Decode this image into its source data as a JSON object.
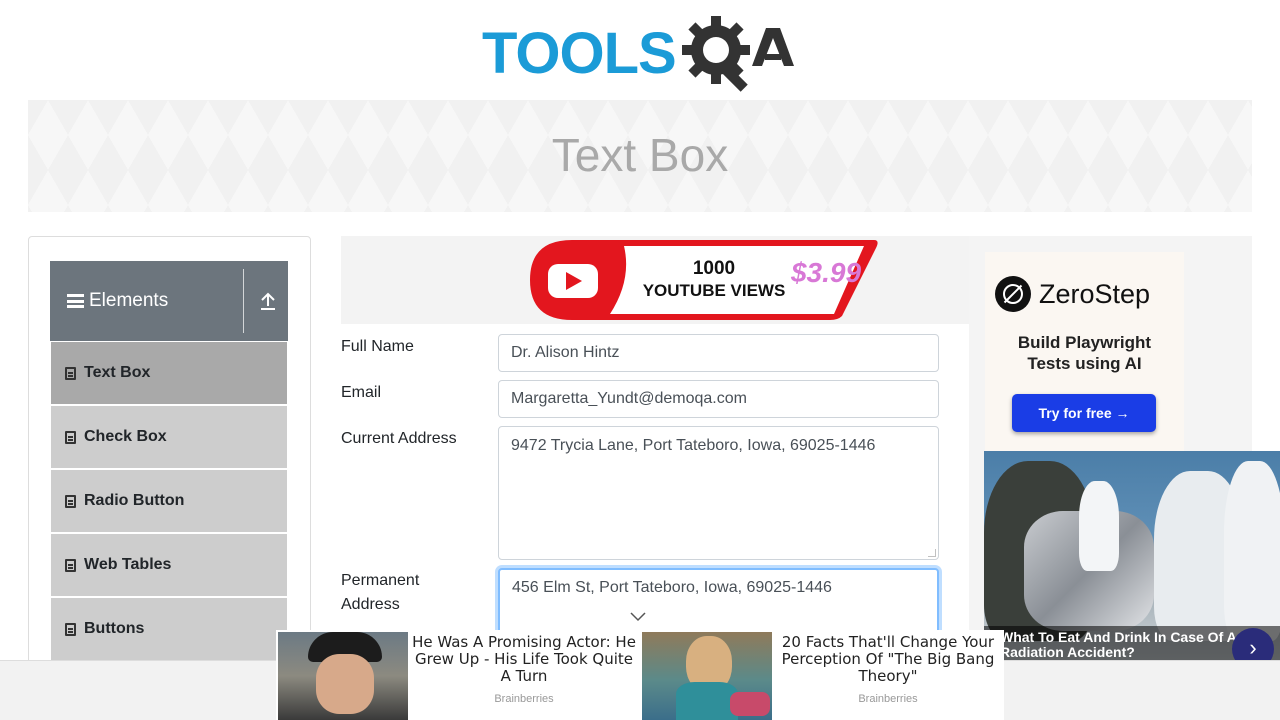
{
  "logo": {
    "left_text": "TOOLS",
    "right_text": "QA"
  },
  "banner": {
    "title": "Text Box"
  },
  "sidebar": {
    "group_title": "Elements",
    "items": [
      {
        "label": "Text Box",
        "active": true
      },
      {
        "label": "Check Box",
        "active": false
      },
      {
        "label": "Radio Button",
        "active": false
      },
      {
        "label": "Web Tables",
        "active": false
      },
      {
        "label": "Buttons",
        "active": false
      }
    ]
  },
  "ad_top": {
    "line1": "1000",
    "line2": "YOUTUBE VIEWS",
    "price": "$3.99"
  },
  "form": {
    "full_name_label": "Full Name",
    "full_name_value": "Dr. Alison Hintz",
    "email_label": "Email",
    "email_value": "Margaretta_Yundt@demoqa.com",
    "current_address_label": "Current Address",
    "current_address_value": "9472 Trycia Lane, Port Tateboro, Iowa, 69025-1446",
    "permanent_address_label_1": "Permanent",
    "permanent_address_label_2": "Address",
    "permanent_address_value": "456 Elm St, Port Tateboro, Iowa, 69025-1446"
  },
  "ad_right": {
    "brand": "ZeroStep",
    "tagline_1": "Build Playwright",
    "tagline_2": "Tests using AI",
    "button": "Try for free →",
    "news_caption_1": "What To Eat And Drink In Case Of A",
    "news_caption_2": "Radiation Accident?",
    "next_arrow": "›"
  },
  "ad_bottom": {
    "items": [
      {
        "title": "He Was A Promising Actor: He Grew Up - His Life Took Quite A Turn",
        "source": "Brainberries"
      },
      {
        "title": "20 Facts That'll Change Your Perception Of \"The Big Bang Theory\"",
        "source": "Brainberries"
      }
    ]
  },
  "colors": {
    "brand_blue": "#1b9bd7",
    "brand_dark": "#333333",
    "sidebar_header": "#6c757d",
    "menu_item": "#cdcdcd",
    "menu_active": "#a9a9a9",
    "focus_border": "#80bdff"
  }
}
